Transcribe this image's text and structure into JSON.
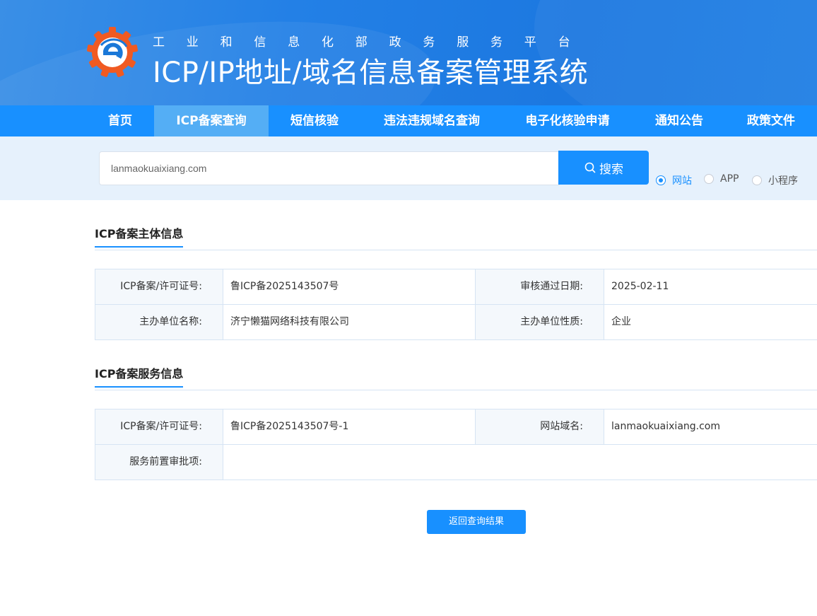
{
  "header": {
    "subtitle": "工业和信息化部政务服务平台",
    "title": "ICP/IP地址/域名信息备案管理系统"
  },
  "nav": {
    "items": [
      {
        "label": "首页",
        "active": false
      },
      {
        "label": "ICP备案查询",
        "active": true
      },
      {
        "label": "短信核验",
        "active": false
      },
      {
        "label": "违法违规域名查询",
        "active": false
      },
      {
        "label": "电子化核验申请",
        "active": false
      },
      {
        "label": "通知公告",
        "active": false
      },
      {
        "label": "政策文件",
        "active": false
      }
    ]
  },
  "search": {
    "value": "lanmaokuaixiang.com",
    "button_label": "搜索",
    "types": [
      {
        "label": "网站",
        "checked": true
      },
      {
        "label": "APP",
        "checked": false
      },
      {
        "label": "小程序",
        "checked": false
      }
    ]
  },
  "subject_info": {
    "heading": "ICP备案主体信息",
    "license_label": "ICP备案/许可证号:",
    "license_value": "鲁ICP备2025143507号",
    "approve_date_label": "审核通过日期:",
    "approve_date_value": "2025-02-11",
    "org_name_label": "主办单位名称:",
    "org_name_value": "济宁懒猫网络科技有限公司",
    "org_type_label": "主办单位性质:",
    "org_type_value": "企业"
  },
  "service_info": {
    "heading": "ICP备案服务信息",
    "license_label": "ICP备案/许可证号:",
    "license_value": "鲁ICP备2025143507号-1",
    "domain_label": "网站域名:",
    "domain_value": "lanmaokuaixiang.com",
    "preapproval_label": "服务前置审批项:",
    "preapproval_value": ""
  },
  "back_button_label": "返回查询结果",
  "colors": {
    "primary": "#1890ff",
    "nav_active": "#54aef5",
    "search_band": "#e6f1fc",
    "logo_orange": "#f05a22"
  }
}
